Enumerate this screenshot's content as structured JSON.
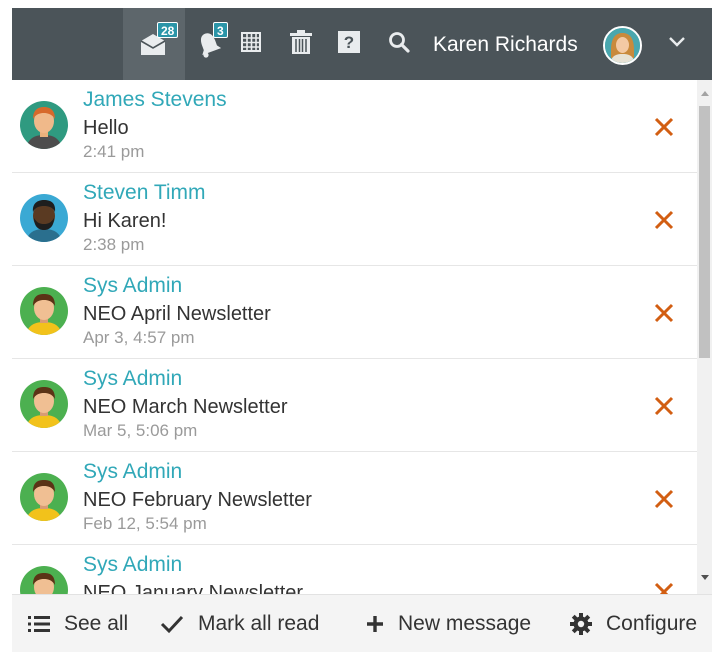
{
  "header": {
    "messages_badge": "28",
    "notifications_badge": "3",
    "user_name": "Karen Richards"
  },
  "messages": [
    {
      "sender": "James Stevens",
      "subject": "Hello",
      "time": "2:41 pm",
      "avatar": "avatar-orange-hair-man"
    },
    {
      "sender": "Steven Timm",
      "subject": "Hi Karen!",
      "time": "2:38 pm",
      "avatar": "avatar-bearded-man"
    },
    {
      "sender": "Sys Admin",
      "subject": "NEO April Newsletter",
      "time": "Apr 3, 4:57 pm",
      "avatar": "avatar-admin"
    },
    {
      "sender": "Sys Admin",
      "subject": "NEO March Newsletter",
      "time": "Mar 5, 5:06 pm",
      "avatar": "avatar-admin"
    },
    {
      "sender": "Sys Admin",
      "subject": "NEO February Newsletter",
      "time": "Feb 12, 5:54 pm",
      "avatar": "avatar-admin"
    },
    {
      "sender": "Sys Admin",
      "subject": "NEO January Newsletter",
      "time": "",
      "avatar": "avatar-admin"
    }
  ],
  "footer": {
    "see_all": "See all",
    "mark_all_read": "Mark all read",
    "new_message": "New message",
    "configure": "Configure"
  },
  "colors": {
    "topbar": "#4b5459",
    "sender_link": "#31a8b8",
    "delete": "#d25e12",
    "badge": "#2b95a8"
  }
}
